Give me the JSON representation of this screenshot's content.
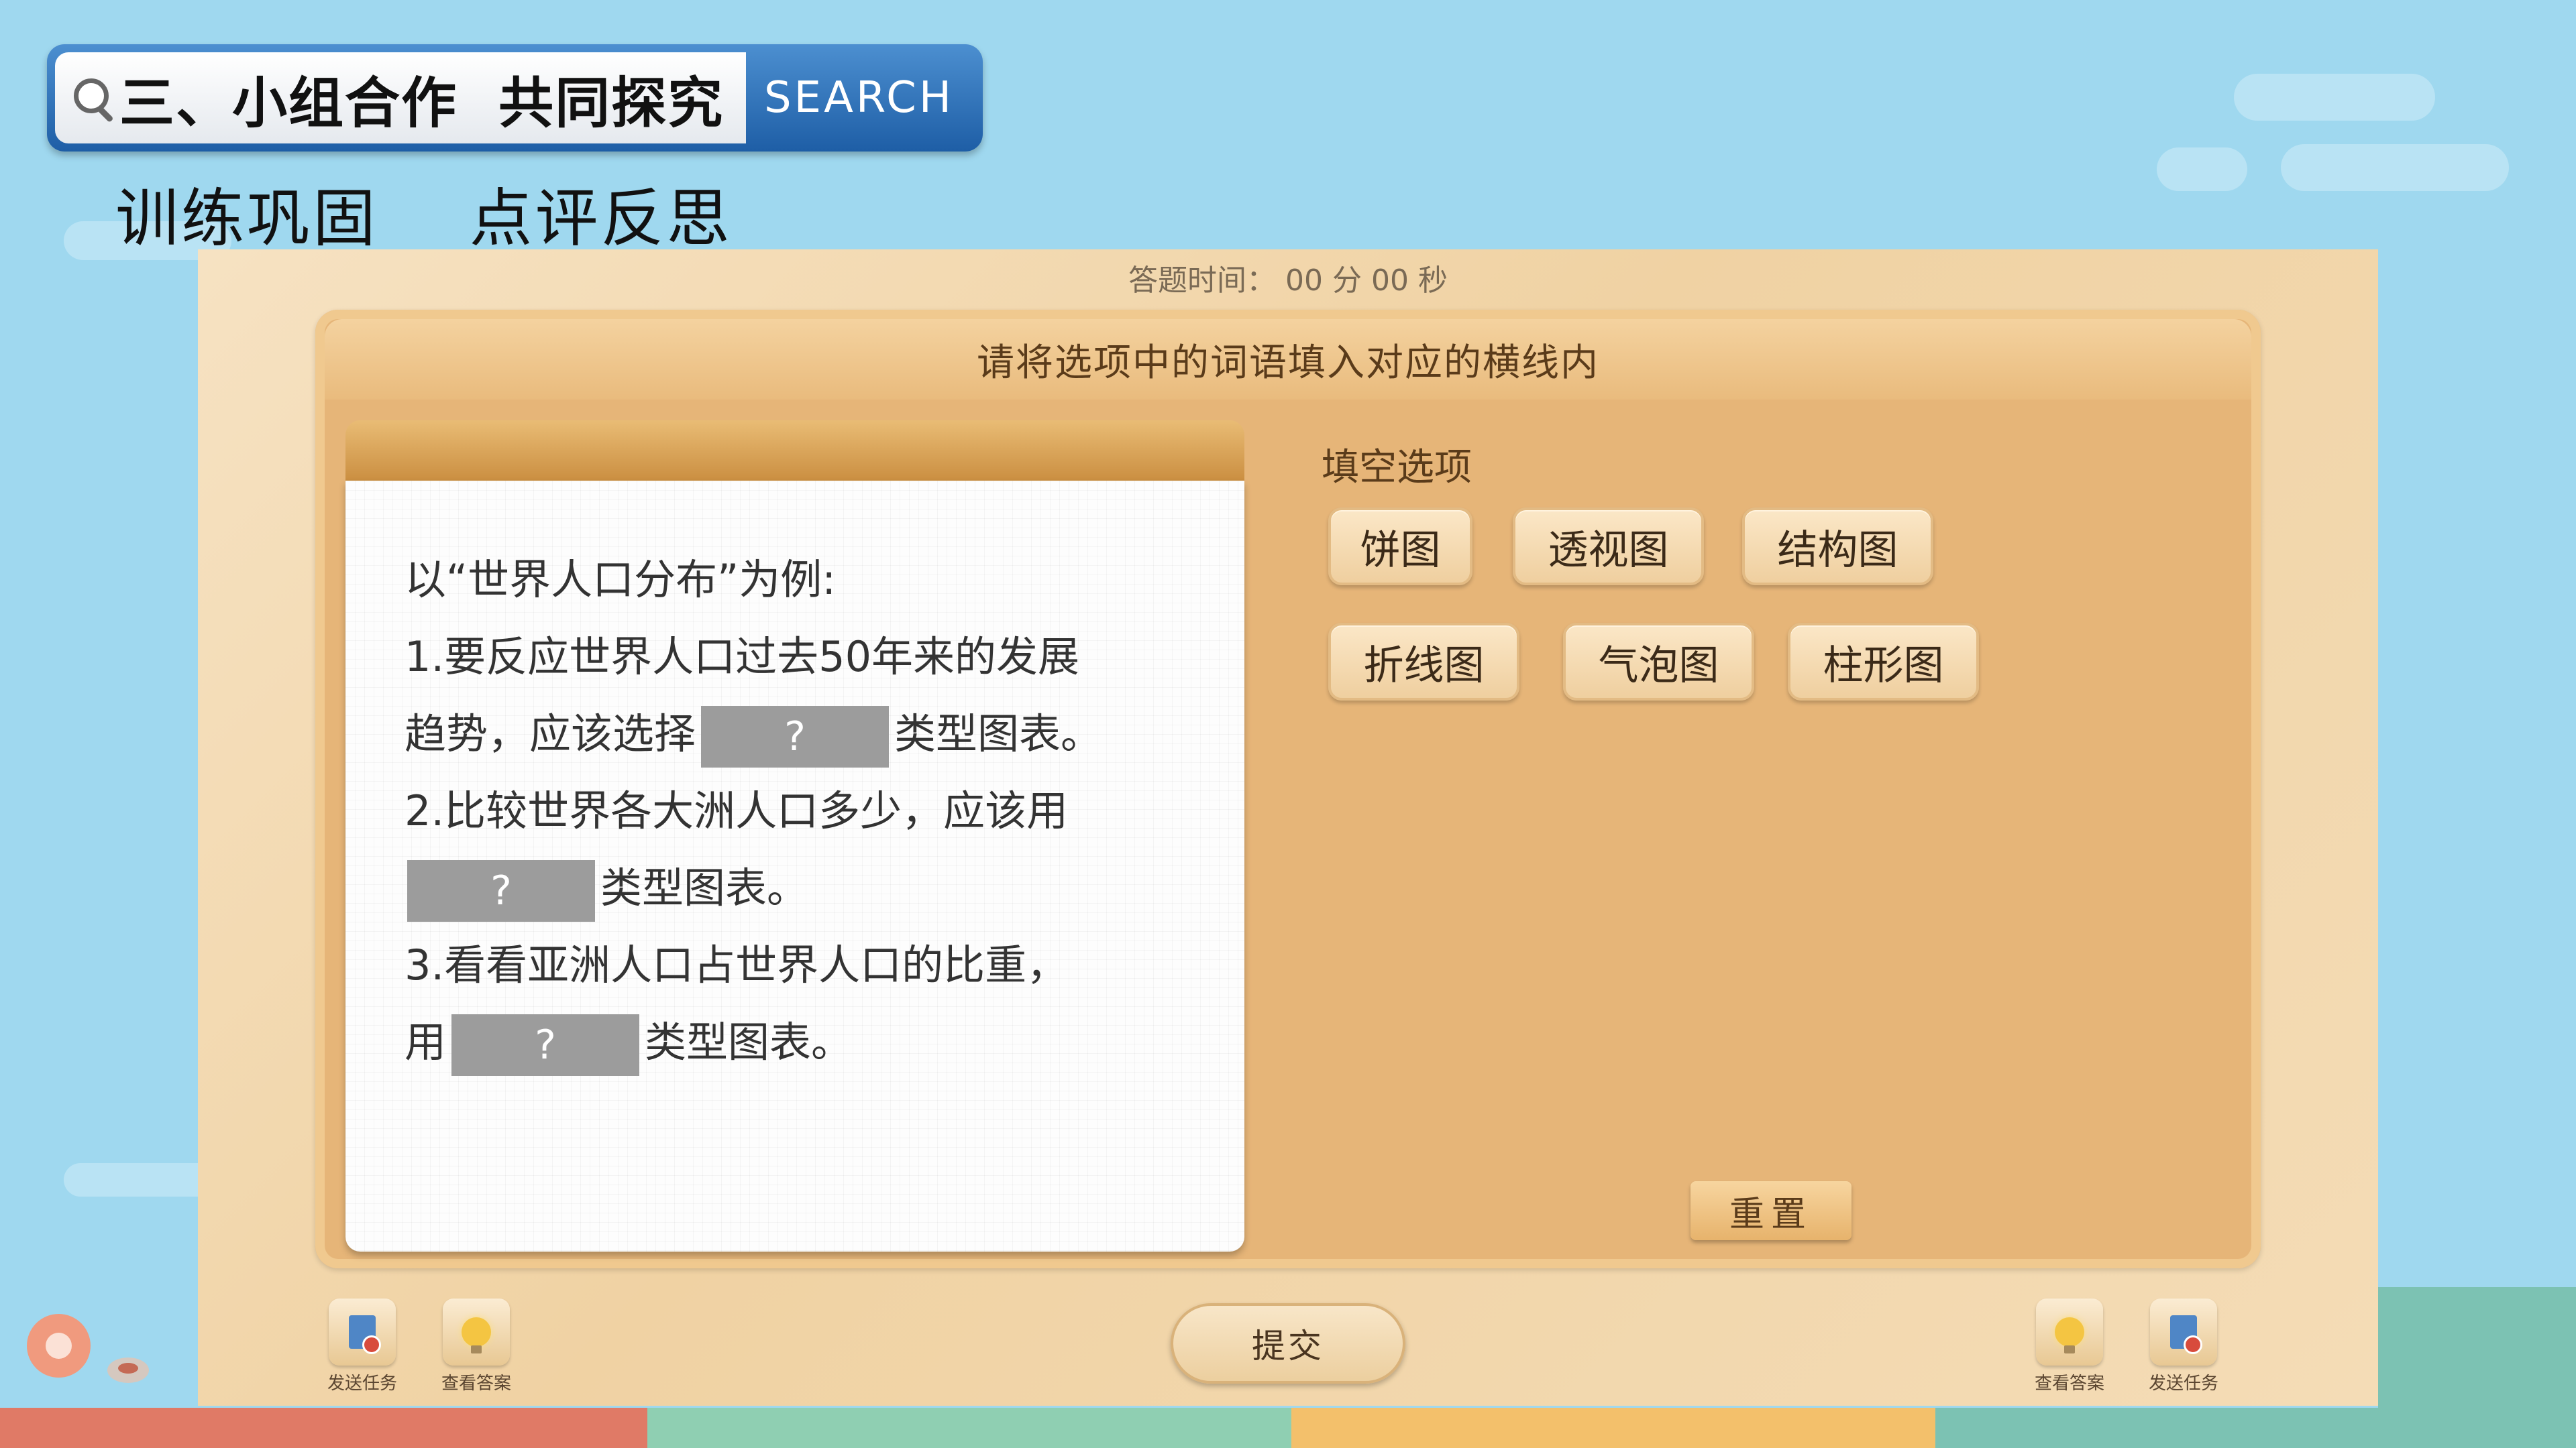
{
  "header": {
    "title": "三、小组合作  共同探究",
    "search_button": "SEARCH",
    "subtitle": "训练巩固    点评反思"
  },
  "board": {
    "timer": "答题时间： 00 分 00 秒",
    "instruction": "请将选项中的词语填入对应的横线内",
    "question": {
      "intro": "以“世界人口分布”为例:",
      "q1_a": "1.要反应世界人口过去50年来的发展",
      "q1_b": "趋势，应该选择",
      "q1_c": "类型图表。",
      "q2_a": "2.比较世界各大洲人口多少，应该用",
      "q2_b": "类型图表。",
      "q3_a": "3.看看亚洲人口占世界人口的比重，",
      "q3_b": "用",
      "q3_c": "类型图表。",
      "blank_mark": "?"
    },
    "options_label": "填空选项",
    "options": [
      "饼图",
      "透视图",
      "结构图",
      "折线图",
      "气泡图",
      "柱形图"
    ],
    "reset_label": "重置",
    "submit_label": "提交"
  },
  "toolbar": {
    "left": [
      {
        "label": "发送任务",
        "icon": "send-task-icon"
      },
      {
        "label": "查看答案",
        "icon": "lightbulb-icon"
      }
    ],
    "right": [
      {
        "label": "查看答案",
        "icon": "lightbulb-icon"
      },
      {
        "label": "发送任务",
        "icon": "send-task-icon"
      }
    ]
  },
  "colors": {
    "background": "#9fd8ef",
    "search_blue": "#1e5ea6",
    "board_wood": "#f0d2a3",
    "panel_wood": "#e6b578",
    "blank_gray": "#9c9c9c",
    "stripe": [
      "#e07a66",
      "#8fcfb2",
      "#f3c06b",
      "#7cc2b3"
    ]
  }
}
